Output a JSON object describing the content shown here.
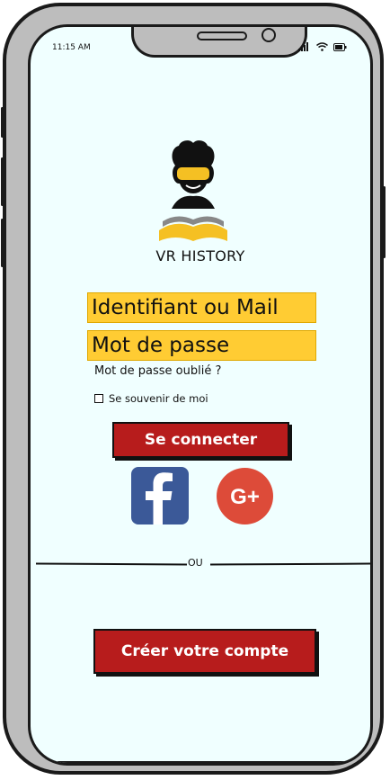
{
  "status_bar": {
    "time": "11:15 AM"
  },
  "app": {
    "name": "VR HISTORY"
  },
  "login_form": {
    "username_placeholder": "Identifiant ou Mail",
    "password_placeholder": "Mot de passe",
    "forgot_password": "Mot de passe oublié ?",
    "remember_me": "Se souvenir de moi",
    "login_button": "Se connecter"
  },
  "social": {
    "facebook_icon": "facebook-icon",
    "google_plus_icon": "google-plus-icon",
    "google_plus_label": "G+"
  },
  "divider": {
    "label": "OU"
  },
  "signup": {
    "button": "Créer votre compte"
  },
  "colors": {
    "field_bg": "#ffcc33",
    "button_bg": "#b71c1c",
    "screen_bg": "#f0ffff",
    "facebook": "#3b5998",
    "google_plus": "#dd4b39"
  }
}
